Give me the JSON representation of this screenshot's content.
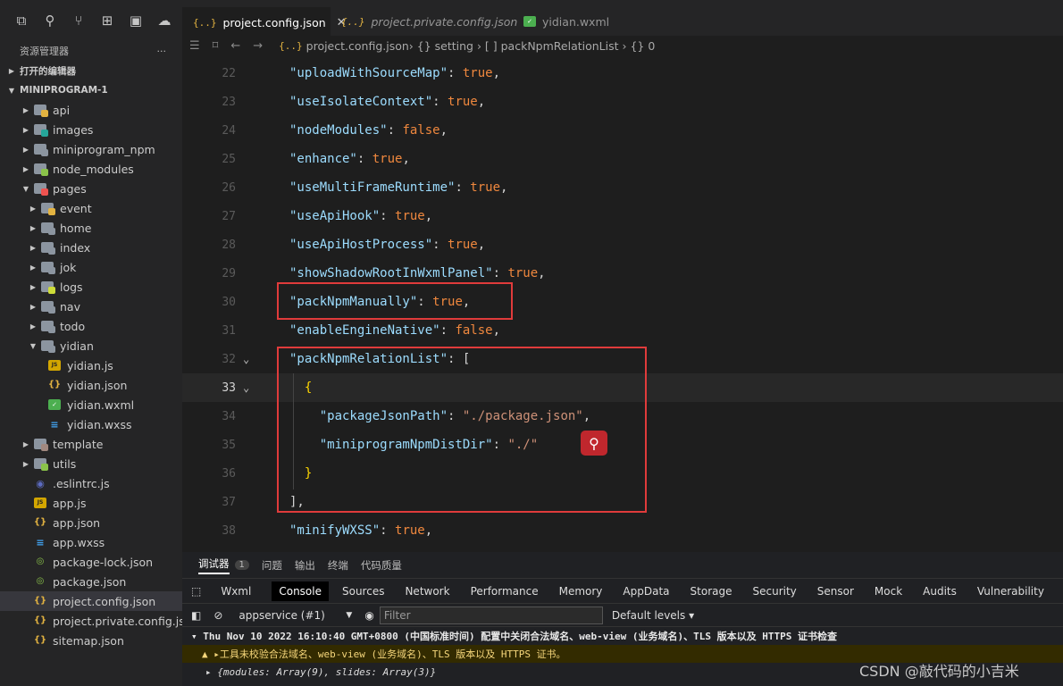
{
  "sidebar": {
    "title": "资源管理器",
    "more": "···",
    "sections": {
      "open_editors": "打开的编辑器",
      "project": "MINIPROGRAM-1"
    },
    "tree": [
      {
        "label": "api",
        "depth": 1,
        "type": "folder",
        "color": "#e3b341",
        "open": false
      },
      {
        "label": "images",
        "depth": 1,
        "type": "folder",
        "color": "#26a69a",
        "open": false
      },
      {
        "label": "miniprogram_npm",
        "depth": 1,
        "type": "folder",
        "color": "#8c95a0",
        "open": false
      },
      {
        "label": "node_modules",
        "depth": 1,
        "type": "folder",
        "color": "#8bc34a",
        "open": false
      },
      {
        "label": "pages",
        "depth": 1,
        "type": "folder",
        "color": "#ef5350",
        "open": true
      },
      {
        "label": "event",
        "depth": 2,
        "type": "folder",
        "color": "#e3b341",
        "open": false
      },
      {
        "label": "home",
        "depth": 2,
        "type": "folder",
        "color": "#8c95a0",
        "open": false
      },
      {
        "label": "index",
        "depth": 2,
        "type": "folder",
        "color": "#8c95a0",
        "open": false
      },
      {
        "label": "jok",
        "depth": 2,
        "type": "folder",
        "color": "#8c95a0",
        "open": false
      },
      {
        "label": "logs",
        "depth": 2,
        "type": "folder",
        "color": "#cddc39",
        "open": false
      },
      {
        "label": "nav",
        "depth": 2,
        "type": "folder",
        "color": "#8c95a0",
        "open": false
      },
      {
        "label": "todo",
        "depth": 2,
        "type": "folder",
        "color": "#8c95a0",
        "open": false
      },
      {
        "label": "yidian",
        "depth": 2,
        "type": "folder",
        "color": "#8c95a0",
        "open": true
      },
      {
        "label": "yidian.js",
        "depth": 3,
        "type": "js"
      },
      {
        "label": "yidian.json",
        "depth": 3,
        "type": "json"
      },
      {
        "label": "yidian.wxml",
        "depth": 3,
        "type": "wxml"
      },
      {
        "label": "yidian.wxss",
        "depth": 3,
        "type": "css"
      },
      {
        "label": "template",
        "depth": 1,
        "type": "folder",
        "color": "#a1887f",
        "open": false
      },
      {
        "label": "utils",
        "depth": 1,
        "type": "folder",
        "color": "#8bc34a",
        "open": false
      },
      {
        "label": ".eslintrc.js",
        "depth": 1,
        "type": "eslint"
      },
      {
        "label": "app.js",
        "depth": 1,
        "type": "js"
      },
      {
        "label": "app.json",
        "depth": 1,
        "type": "json"
      },
      {
        "label": "app.wxss",
        "depth": 1,
        "type": "css"
      },
      {
        "label": "package-lock.json",
        "depth": 1,
        "type": "pkg"
      },
      {
        "label": "package.json",
        "depth": 1,
        "type": "pkg"
      },
      {
        "label": "project.config.json",
        "depth": 1,
        "type": "json",
        "selected": true
      },
      {
        "label": "project.private.config.js...",
        "depth": 1,
        "type": "json"
      },
      {
        "label": "sitemap.json",
        "depth": 1,
        "type": "json"
      }
    ]
  },
  "tabs": [
    {
      "label": "project.config.json",
      "icon": "{..}",
      "active": true,
      "close": "✕"
    },
    {
      "label": "project.private.config.json",
      "icon": "{..}",
      "active": false
    },
    {
      "label": "yidian.wxml",
      "icon": "wxml-icon",
      "active": false
    }
  ],
  "breadcrumb": {
    "file": "project.config.json",
    "path": " › {} setting › [ ] packNpmRelationList › {} 0"
  },
  "editor": {
    "lines": [
      {
        "n": "22",
        "tokens": [
          [
            "k",
            "\"uploadWithSourceMap\""
          ],
          [
            "p",
            ": "
          ],
          [
            "bo",
            "true"
          ],
          [
            "p",
            ","
          ]
        ]
      },
      {
        "n": "23",
        "tokens": [
          [
            "k",
            "\"useIsolateContext\""
          ],
          [
            "p",
            ": "
          ],
          [
            "bo",
            "true"
          ],
          [
            "p",
            ","
          ]
        ]
      },
      {
        "n": "24",
        "tokens": [
          [
            "k",
            "\"nodeModules\""
          ],
          [
            "p",
            ": "
          ],
          [
            "bo",
            "false"
          ],
          [
            "p",
            ","
          ]
        ]
      },
      {
        "n": "25",
        "tokens": [
          [
            "k",
            "\"enhance\""
          ],
          [
            "p",
            ": "
          ],
          [
            "bo",
            "true"
          ],
          [
            "p",
            ","
          ]
        ]
      },
      {
        "n": "26",
        "tokens": [
          [
            "k",
            "\"useMultiFrameRuntime\""
          ],
          [
            "p",
            ": "
          ],
          [
            "bo",
            "true"
          ],
          [
            "p",
            ","
          ]
        ]
      },
      {
        "n": "27",
        "tokens": [
          [
            "k",
            "\"useApiHook\""
          ],
          [
            "p",
            ": "
          ],
          [
            "bo",
            "true"
          ],
          [
            "p",
            ","
          ]
        ]
      },
      {
        "n": "28",
        "tokens": [
          [
            "k",
            "\"useApiHostProcess\""
          ],
          [
            "p",
            ": "
          ],
          [
            "bo",
            "true"
          ],
          [
            "p",
            ","
          ]
        ]
      },
      {
        "n": "29",
        "tokens": [
          [
            "k",
            "\"showShadowRootInWxmlPanel\""
          ],
          [
            "p",
            ": "
          ],
          [
            "bo",
            "true"
          ],
          [
            "p",
            ","
          ]
        ]
      },
      {
        "n": "30",
        "tokens": [
          [
            "k",
            "\"packNpmManually\""
          ],
          [
            "p",
            ": "
          ],
          [
            "bo",
            "true"
          ],
          [
            "p",
            ","
          ]
        ]
      },
      {
        "n": "31",
        "tokens": [
          [
            "k",
            "\"enableEngineNative\""
          ],
          [
            "p",
            ": "
          ],
          [
            "bo",
            "false"
          ],
          [
            "p",
            ","
          ]
        ]
      },
      {
        "n": "32",
        "fold": true,
        "tokens": [
          [
            "k",
            "\"packNpmRelationList\""
          ],
          [
            "p",
            ": "
          ],
          [
            "p",
            "["
          ]
        ]
      },
      {
        "n": "33",
        "fold": true,
        "current": true,
        "tokens": [
          [
            "br",
            "  {"
          ]
        ]
      },
      {
        "n": "34",
        "tokens": [
          [
            "p",
            "    "
          ],
          [
            "k",
            "\"packageJsonPath\""
          ],
          [
            "p",
            ": "
          ],
          [
            "s",
            "\"./package.json\""
          ],
          [
            "p",
            ","
          ]
        ]
      },
      {
        "n": "35",
        "tokens": [
          [
            "p",
            "    "
          ],
          [
            "k",
            "\"miniprogramNpmDistDir\""
          ],
          [
            "p",
            ": "
          ],
          [
            "s",
            "\"./\""
          ]
        ]
      },
      {
        "n": "36",
        "tokens": [
          [
            "br",
            "  }"
          ]
        ]
      },
      {
        "n": "37",
        "tokens": [
          [
            "p",
            "],"
          ]
        ]
      },
      {
        "n": "38",
        "tokens": [
          [
            "k",
            "\"minifyWXSS\""
          ],
          [
            "p",
            ": "
          ],
          [
            "bo",
            "true"
          ],
          [
            "p",
            ","
          ]
        ]
      }
    ]
  },
  "devtools": {
    "panel_tabs": [
      "调试器",
      "问题",
      "输出",
      "终端",
      "代码质量"
    ],
    "issue_count": "1",
    "tools": [
      "Wxml",
      "Console",
      "Sources",
      "Network",
      "Performance",
      "Memory",
      "AppData",
      "Storage",
      "Security",
      "Sensor",
      "Mock",
      "Audits",
      "Vulnerability"
    ],
    "context": "appservice (#1)",
    "filter_placeholder": "Filter",
    "levels": "Default levels ▾",
    "logs": [
      "▾ Thu Nov 10 2022 16:10:40 GMT+0800 (中国标准时间) 配置中关闭合法域名、web-view (业务域名)、TLS 版本以及 HTTPS 证书检查",
      "▲ ▸工具未校验合法域名、web-view (业务域名)、TLS 版本以及 HTTPS 证书。",
      "▸ {modules: Array(9), slides: Array(3)}"
    ]
  },
  "watermark": "CSDN @敲代码的小吉米"
}
